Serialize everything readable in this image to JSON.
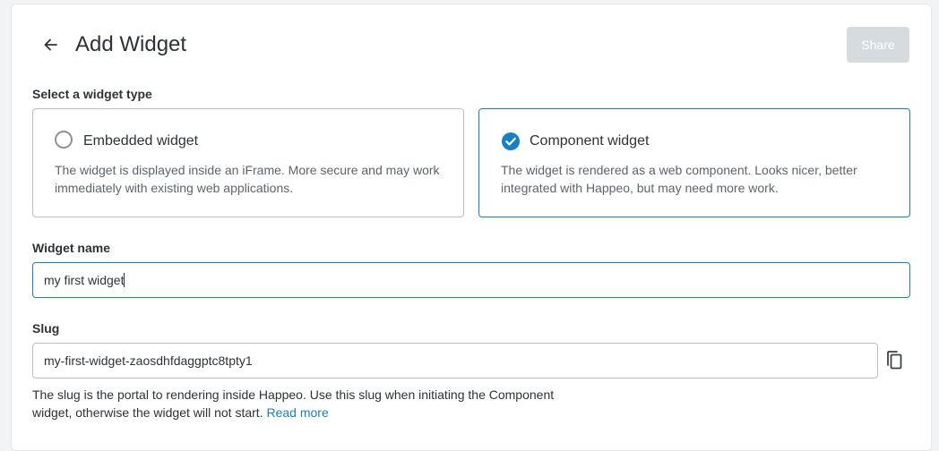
{
  "header": {
    "title": "Add Widget",
    "share_label": "Share"
  },
  "widget_type": {
    "label": "Select a widget type",
    "options": [
      {
        "title": "Embedded widget",
        "description": "The widget is displayed inside an iFrame. More secure and may work immediately with existing web applications.",
        "selected": false
      },
      {
        "title": "Component widget",
        "description": "The widget is rendered as a web component. Looks nicer, better integrated with Happeo, but may need more work.",
        "selected": true
      }
    ]
  },
  "widget_name": {
    "label": "Widget name",
    "value": "my first widget"
  },
  "slug": {
    "label": "Slug",
    "value": "my-first-widget-zaosdhfdaggptc8tpty1",
    "help_text": "The slug is the portal to rendering inside Happeo. Use this slug when initiating the Component widget, otherwise the widget will not start.",
    "read_more_label": "Read more"
  },
  "colors": {
    "accent": "#1a7ec2",
    "disabled_button": "#d6dbe0",
    "text": "#2d3338",
    "muted_text": "#5b6570"
  },
  "icons": {
    "back": "arrow-left-icon",
    "selected": "check-circle-icon",
    "unselected": "radio-empty-icon",
    "copy": "copy-icon"
  }
}
